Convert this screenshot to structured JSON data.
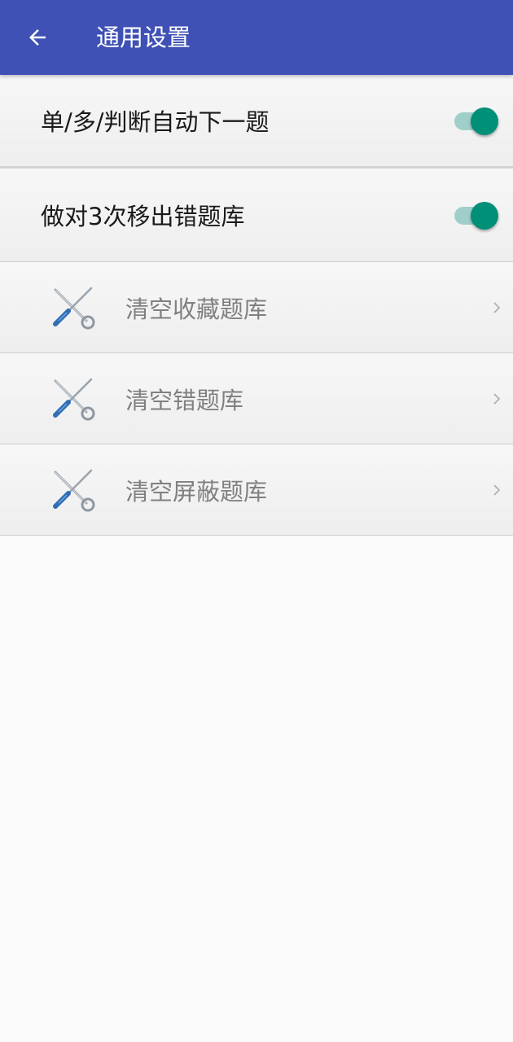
{
  "app_bar": {
    "title": "通用设置",
    "back_icon": "arrow-left-icon",
    "background_color": "#3f51b5"
  },
  "settings": {
    "toggles": [
      {
        "label": "单/多/判断自动下一题",
        "checked": true
      },
      {
        "label": "做对3次移出错题库",
        "checked": true
      }
    ],
    "actions": [
      {
        "label": "清空收藏题库",
        "icon": "tools-icon",
        "chevron": "chevron-right-icon"
      },
      {
        "label": "清空错题库",
        "icon": "tools-icon",
        "chevron": "chevron-right-icon"
      },
      {
        "label": "清空屏蔽题库",
        "icon": "tools-icon",
        "chevron": "chevron-right-icon"
      }
    ],
    "accent_color": "#009077"
  }
}
